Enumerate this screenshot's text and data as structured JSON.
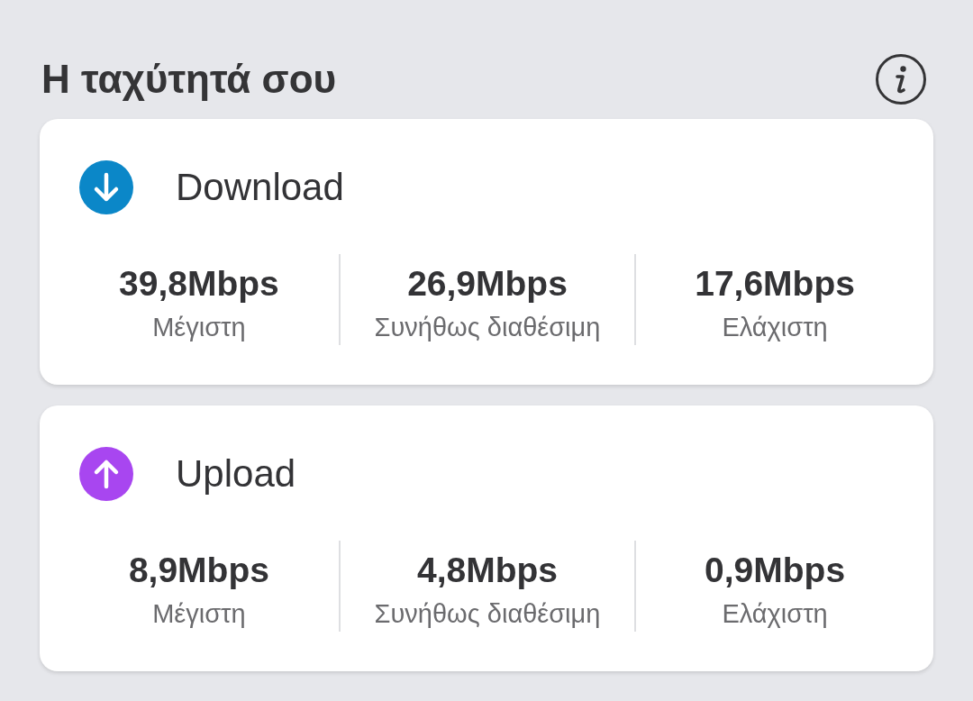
{
  "header": {
    "title": "Η ταχύτητά σου"
  },
  "speed_cards": [
    {
      "kind": "download",
      "color": "#0b87c8",
      "title": "Download",
      "stats": [
        {
          "value": "39,8Mbps",
          "label": "Μέγιστη"
        },
        {
          "value": "26,9Mbps",
          "label": "Συνήθως διαθέσιμη"
        },
        {
          "value": "17,6Mbps",
          "label": "Ελάχιστη"
        }
      ]
    },
    {
      "kind": "upload",
      "color": "#a846f0",
      "title": "Upload",
      "stats": [
        {
          "value": "8,9Mbps",
          "label": "Μέγιστη"
        },
        {
          "value": "4,8Mbps",
          "label": "Συνήθως διαθέσιμη"
        },
        {
          "value": "0,9Mbps",
          "label": "Ελάχιστη"
        }
      ]
    }
  ]
}
